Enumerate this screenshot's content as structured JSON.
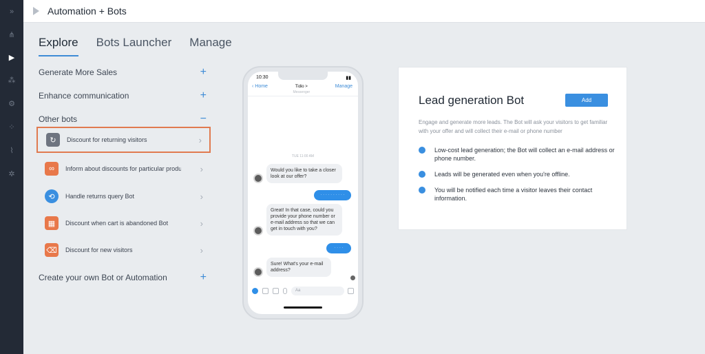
{
  "app": {
    "title": "Automation + Bots"
  },
  "rail": {
    "icons": [
      "collapse-icon",
      "chart-icon",
      "play-icon",
      "users-icon",
      "gear-icon",
      "network-icon",
      "stats-icon",
      "settings-icon"
    ]
  },
  "tabs": [
    {
      "label": "Explore",
      "active": true
    },
    {
      "label": "Bots Launcher",
      "active": false
    },
    {
      "label": "Manage",
      "active": false
    }
  ],
  "sections": {
    "sales": {
      "label": "Generate More Sales",
      "sign": "+"
    },
    "communication": {
      "label": "Enhance communication",
      "sign": "+"
    },
    "other": {
      "label": "Other bots",
      "sign": "−"
    },
    "create": {
      "label": "Create your own Bot or Automation",
      "sign": "+"
    }
  },
  "bots": [
    {
      "label": "Discount for returning visitors",
      "icon": "refresh-icon",
      "color": "#6e7480"
    },
    {
      "label": "Inform about discounts for particular produ",
      "icon": "link-icon",
      "color": "#e8784a"
    },
    {
      "label": "Handle returns query Bot",
      "icon": "return-icon",
      "color": "#3a8fe0"
    },
    {
      "label": "Discount when cart is abandoned Bot",
      "icon": "grid-icon",
      "color": "#e8784a"
    },
    {
      "label": "Discount for new visitors",
      "icon": "tag-icon",
      "color": "#e8784a"
    }
  ],
  "phone": {
    "time": "10:30",
    "nav_back": "Home",
    "nav_name": "Tidio >",
    "nav_sub": "Messenger",
    "nav_manage": "Manage",
    "timestamp": "TUE 11:00 AM",
    "msg1": "Would you like to take a closer look at our offer?",
    "msg2": "Great! In that case, could you provide your phone number or e-mail address so that we can get in touch with you?",
    "msg3": "Sure! What's your e-mail address?",
    "reply1": "· · · · · · · · · ·",
    "reply2": "· · · ·",
    "composer_placeholder": "Aa"
  },
  "card": {
    "title": "Lead generation Bot",
    "add_label": "Add",
    "description": "Engage and generate more leads. The Bot will ask your visitors to get familiar with your offer and will collect their e-mail or phone number",
    "bullets": [
      "Low-cost lead generation; the Bot will collect an e-mail address or phone number.",
      "Leads will be generated even when you're offline.",
      "You will be notified each time a visitor leaves their contact information."
    ]
  },
  "colors": {
    "accent": "#3a8fe0",
    "selected_border": "#e07a4f",
    "rail": "#232a36"
  }
}
